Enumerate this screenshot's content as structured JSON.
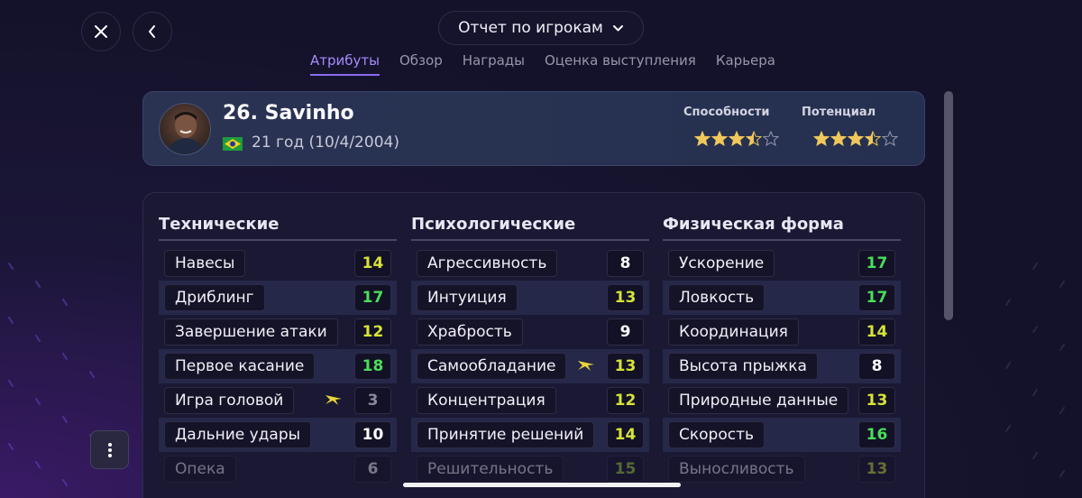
{
  "header": {
    "title": "Отчет по игрокам",
    "tabs": [
      "Атрибуты",
      "Обзор",
      "Награды",
      "Оценка выступления",
      "Карьера"
    ],
    "active_tab": "Атрибуты"
  },
  "player": {
    "name": "26. Savinho",
    "age": "21 год (10/4/2004)",
    "nationality_flag": "brazil-flag-icon",
    "ability_label": "Способности",
    "potential_label": "Потенциал",
    "ability_stars": 3.5,
    "potential_stars": 3.5,
    "max_stars": 5
  },
  "colors": {
    "accent": "#8b6cf0",
    "star": "#f0c75a",
    "value_18": "#4ade5a",
    "value_17": "#4ade5a",
    "value_16": "#4ade5a",
    "value_15": "#a5d63a",
    "value_14": "#d6e33a",
    "value_13": "#d6e33a",
    "value_12": "#d6e33a",
    "value_low": "#ffffff",
    "value_3": "#7a7890",
    "boost": "#e8d43a"
  },
  "columns": [
    {
      "title": "Технические",
      "rows": [
        {
          "name": "Навесы",
          "value": "14",
          "color": "#d6e33a"
        },
        {
          "name": "Дриблинг",
          "value": "17",
          "color": "#4ade5a"
        },
        {
          "name": "Завершение атаки",
          "value": "12",
          "color": "#d6e33a"
        },
        {
          "name": "Первое касание",
          "value": "18",
          "color": "#4ade5a"
        },
        {
          "name": "Игра головой",
          "value": "3",
          "color": "#8a889e",
          "boost": true
        },
        {
          "name": "Дальние удары",
          "value": "10",
          "color": "#ffffff"
        },
        {
          "name": "Опека",
          "value": "6",
          "color": "#ffffff",
          "faded": true
        }
      ]
    },
    {
      "title": "Психологические",
      "rows": [
        {
          "name": "Агрессивность",
          "value": "8",
          "color": "#ffffff"
        },
        {
          "name": "Интуиция",
          "value": "13",
          "color": "#d6e33a"
        },
        {
          "name": "Храбрость",
          "value": "9",
          "color": "#ffffff"
        },
        {
          "name": "Самообладание",
          "value": "13",
          "color": "#d6e33a",
          "boost": true
        },
        {
          "name": "Концентрация",
          "value": "12",
          "color": "#d6e33a"
        },
        {
          "name": "Принятие решений",
          "value": "14",
          "color": "#d6e33a"
        },
        {
          "name": "Решительность",
          "value": "15",
          "color": "#a5d63a",
          "faded": true
        }
      ]
    },
    {
      "title": "Физическая форма",
      "rows": [
        {
          "name": "Ускорение",
          "value": "17",
          "color": "#4ade5a"
        },
        {
          "name": "Ловкость",
          "value": "17",
          "color": "#4ade5a"
        },
        {
          "name": "Координация",
          "value": "14",
          "color": "#d6e33a"
        },
        {
          "name": "Высота прыжка",
          "value": "8",
          "color": "#ffffff"
        },
        {
          "name": "Природные данные",
          "value": "13",
          "color": "#d6e33a"
        },
        {
          "name": "Скорость",
          "value": "16",
          "color": "#4ade5a"
        },
        {
          "name": "Выносливость",
          "value": "13",
          "color": "#d6e33a",
          "faded": true
        }
      ]
    }
  ],
  "icons": {
    "close": "close-icon",
    "back": "chevron-left-icon",
    "dropdown": "chevron-down-icon",
    "more": "more-vertical-icon",
    "boost": "arrow-boost-icon"
  }
}
